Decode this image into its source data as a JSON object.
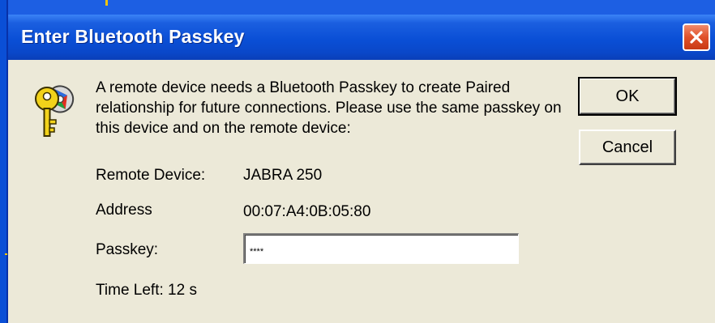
{
  "window": {
    "title": "Enter Bluetooth Passkey",
    "close_icon": "close-icon"
  },
  "dialog": {
    "icon": "keys-icon",
    "message": "A remote device needs a Bluetooth Passkey to create Paired relationship for future connections. Please use the same passkey on this device and on the remote device:",
    "remote_device_label": "Remote Device:",
    "remote_device_value": "JABRA 250",
    "address_label": "Address",
    "address_value": "00:07:A4:0B:05:80",
    "passkey_label": "Passkey:",
    "passkey_value": "****",
    "time_left": "Time Left: 12 s"
  },
  "buttons": {
    "ok_label": "OK",
    "cancel_label": "Cancel"
  },
  "colors": {
    "titlebar": "#0a4fd6",
    "dialog_bg": "#ece9d8",
    "close_button": "#e0512a"
  }
}
